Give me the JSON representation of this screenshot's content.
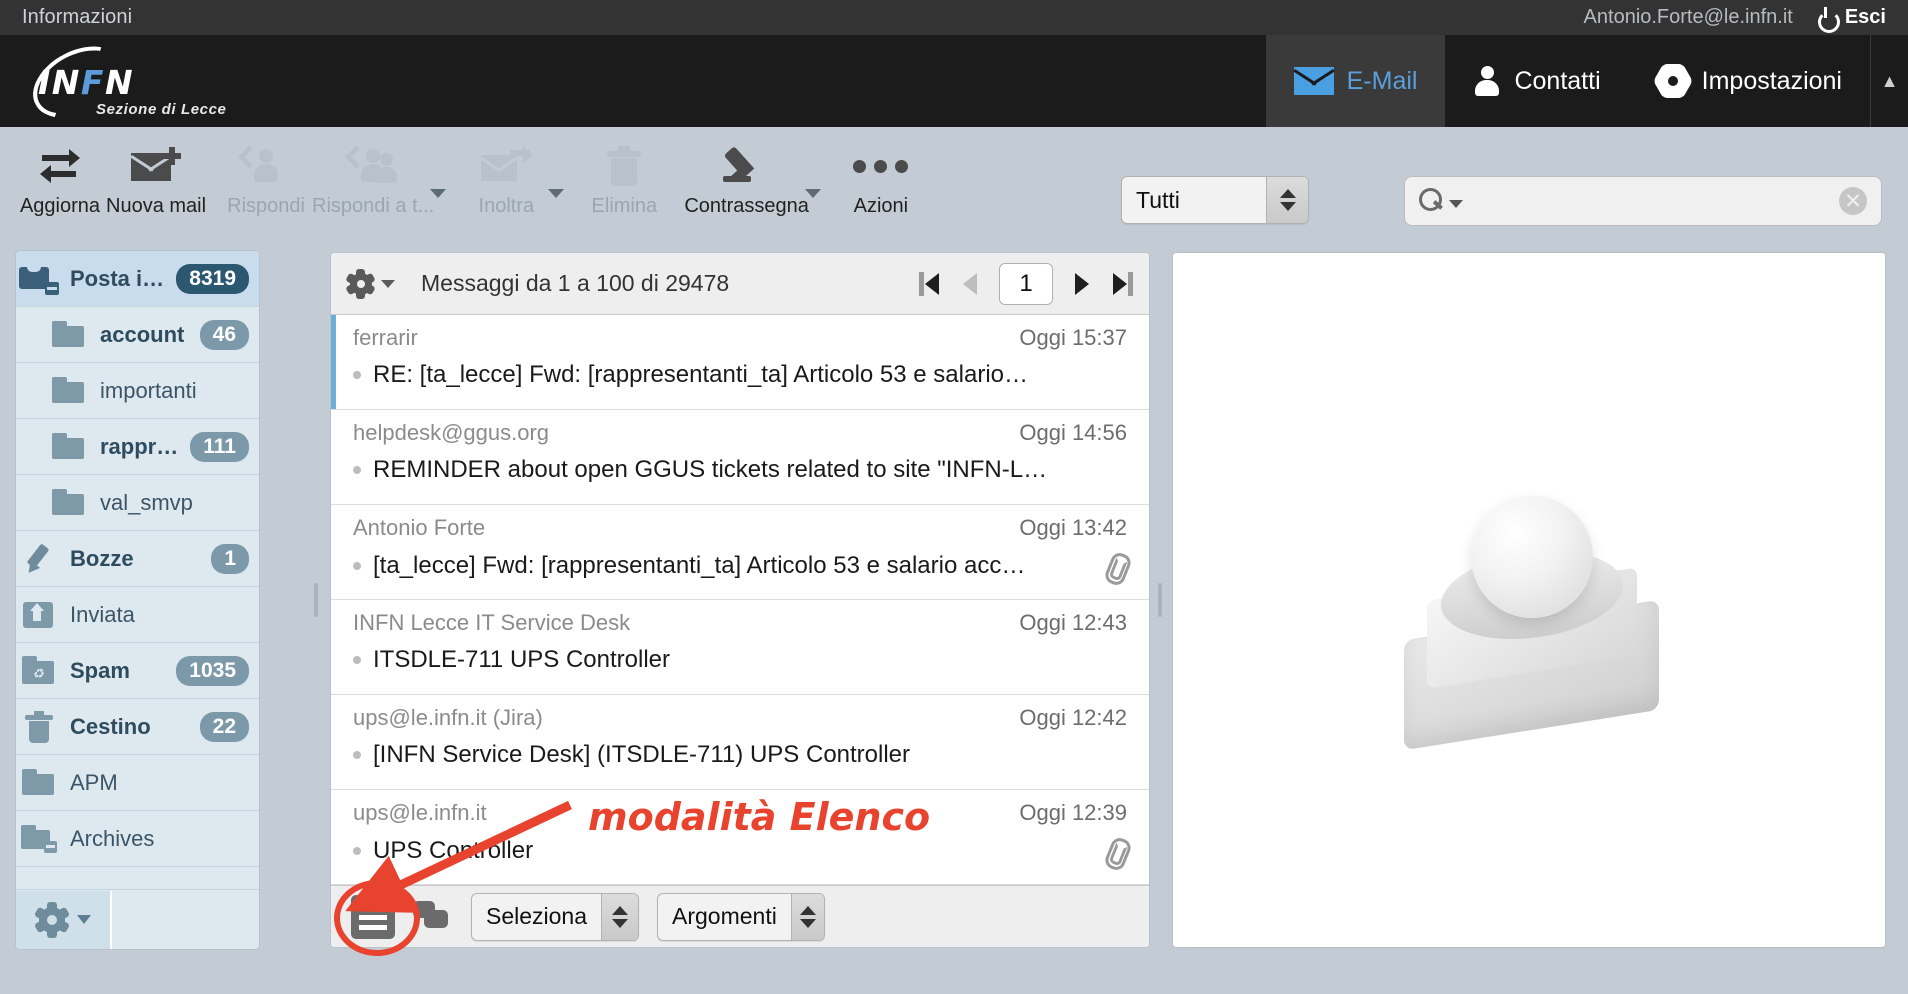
{
  "topbar": {
    "info_link": "Informazioni",
    "user_email": "Antonio.Forte@le.infn.it",
    "logout_label": "Esci",
    "power_icon": "power-icon"
  },
  "brand": {
    "letters_in": "IN",
    "letters_f": "F",
    "letters_n": "N",
    "subtitle": "Sezione di Lecce"
  },
  "tabs": [
    {
      "label": "E-Mail",
      "icon": "mail-icon",
      "active": true
    },
    {
      "label": "Contatti",
      "icon": "person-icon",
      "active": false
    },
    {
      "label": "Impostazioni",
      "icon": "gear-icon",
      "active": false
    }
  ],
  "toolbar": {
    "buttons": [
      {
        "label": "Aggiorna",
        "icon": "refresh-icon",
        "disabled": false,
        "caret": false
      },
      {
        "label": "Nuova mail",
        "icon": "new-mail-icon",
        "disabled": false,
        "caret": false
      },
      {
        "label": "Rispondi",
        "icon": "reply-icon",
        "disabled": true,
        "caret": false
      },
      {
        "label": "Rispondi a t...",
        "icon": "reply-all-icon",
        "disabled": true,
        "caret": true
      },
      {
        "label": "Inoltra",
        "icon": "forward-icon",
        "disabled": true,
        "caret": true
      },
      {
        "label": "Elimina",
        "icon": "trash-icon",
        "disabled": true,
        "caret": false
      },
      {
        "label": "Contrassegna",
        "icon": "marker-pen-icon",
        "disabled": false,
        "caret": true
      },
      {
        "label": "Azioni",
        "icon": "ellipsis-icon",
        "disabled": false,
        "caret": false
      }
    ],
    "filter_value": "Tutti",
    "search_value": "",
    "search_placeholder": ""
  },
  "sidebar": {
    "folders": [
      {
        "name": "Posta in ar...",
        "count": "8319",
        "icon": "inbox-icon",
        "selected": true,
        "indent": false,
        "unread": true
      },
      {
        "name": "account",
        "count": "46",
        "icon": "folder-icon",
        "selected": false,
        "indent": true,
        "unread": true
      },
      {
        "name": "importanti",
        "count": "",
        "icon": "folder-icon",
        "selected": false,
        "indent": true,
        "unread": false
      },
      {
        "name": "rappres...",
        "count": "111",
        "icon": "folder-icon",
        "selected": false,
        "indent": true,
        "unread": true
      },
      {
        "name": "val_smvp",
        "count": "",
        "icon": "folder-icon",
        "selected": false,
        "indent": true,
        "unread": false
      },
      {
        "name": "Bozze",
        "count": "1",
        "icon": "drafts-icon",
        "selected": false,
        "indent": false,
        "unread": true
      },
      {
        "name": "Inviata",
        "count": "",
        "icon": "sent-icon",
        "selected": false,
        "indent": false,
        "unread": false
      },
      {
        "name": "Spam",
        "count": "1035",
        "icon": "spam-icon",
        "selected": false,
        "indent": false,
        "unread": true
      },
      {
        "name": "Cestino",
        "count": "22",
        "icon": "trash-icon",
        "selected": false,
        "indent": false,
        "unread": true
      },
      {
        "name": "APM",
        "count": "",
        "icon": "folder-icon",
        "selected": false,
        "indent": false,
        "unread": false
      },
      {
        "name": "Archives",
        "count": "",
        "icon": "archive-icon",
        "selected": false,
        "indent": false,
        "unread": false
      }
    ],
    "footer_gear_icon": "gear-icon"
  },
  "messagelist": {
    "gear_icon": "gear-icon",
    "count_text": "Messaggi da 1 a 100 di 29478",
    "page_value": "1",
    "pager": {
      "first_icon": "first-page-icon",
      "prev_icon": "prev-page-icon",
      "next_icon": "next-page-icon",
      "last_icon": "last-page-icon"
    },
    "messages": [
      {
        "from": "ferrarir",
        "date": "Oggi 15:37",
        "subject": "RE: [ta_lecce] Fwd: [rappresentanti_ta] Articolo 53 e salario…",
        "attachment": false,
        "selected": true
      },
      {
        "from": "helpdesk@ggus.org",
        "date": "Oggi 14:56",
        "subject": "REMINDER about open GGUS tickets related to site \"INFN-L…",
        "attachment": false,
        "selected": false
      },
      {
        "from": "Antonio Forte",
        "date": "Oggi 13:42",
        "subject": "[ta_lecce] Fwd: [rappresentanti_ta] Articolo 53 e salario acc…",
        "attachment": true,
        "selected": false
      },
      {
        "from": "INFN Lecce IT Service Desk",
        "date": "Oggi 12:43",
        "subject": "ITSDLE-711 UPS Controller",
        "attachment": false,
        "selected": false
      },
      {
        "from": "ups@le.infn.it (Jira)",
        "date": "Oggi 12:42",
        "subject": "[INFN Service Desk] (ITSDLE-711) UPS Controller",
        "attachment": false,
        "selected": false
      },
      {
        "from": "ups@le.infn.it",
        "date": "Oggi 12:39",
        "subject": "UPS Controller",
        "attachment": true,
        "selected": false
      }
    ],
    "footer": {
      "list_mode_icon": "list-view-icon",
      "thread_mode_icon": "thread-view-icon",
      "select_label": "Seleziona",
      "args_label": "Argomenti"
    }
  },
  "annotation": {
    "text": "modalità Elenco",
    "color": "#e8432e"
  }
}
